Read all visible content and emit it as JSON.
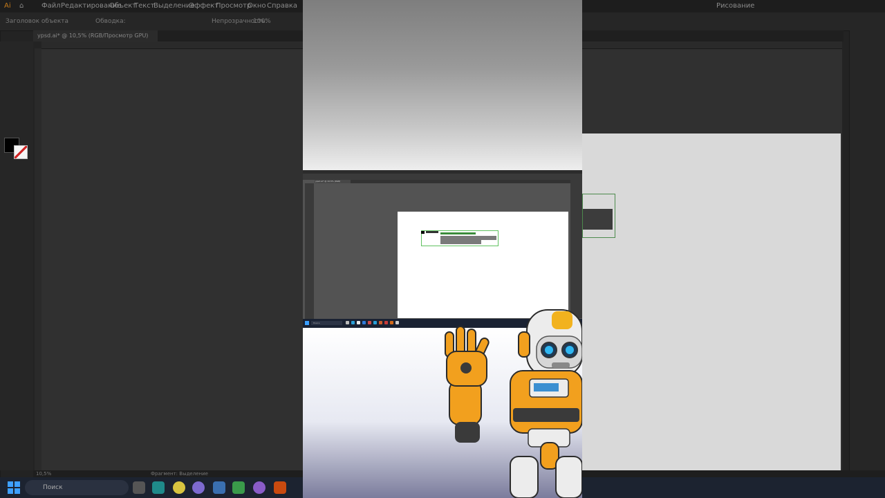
{
  "app": {
    "menu": [
      "Файл",
      "Редактирование",
      "Объект",
      "Текст",
      "Выделение",
      "Эффект",
      "Просмотр",
      "Окно",
      "Справка"
    ],
    "workspace": "Рисование",
    "control_bar": {
      "selection_state": "Заголовок объекта",
      "stroke_label": "Обводка:",
      "opacity_label": "Непрозрачность:",
      "opacity_value": "100%"
    },
    "document_tab": "ypsd.ai* @ 10,5% (RGB/Просмотр GPU)",
    "status": {
      "zoom": "10,5%",
      "tool": "Фрагмент: Выделение"
    }
  },
  "taskbar": {
    "search_placeholder": "Поиск"
  },
  "colors": {
    "accent_selection": "#5fc15f",
    "robot_primary": "#f2a01e",
    "robot_secondary": "#ececec",
    "taskbar": "#1c2330"
  }
}
